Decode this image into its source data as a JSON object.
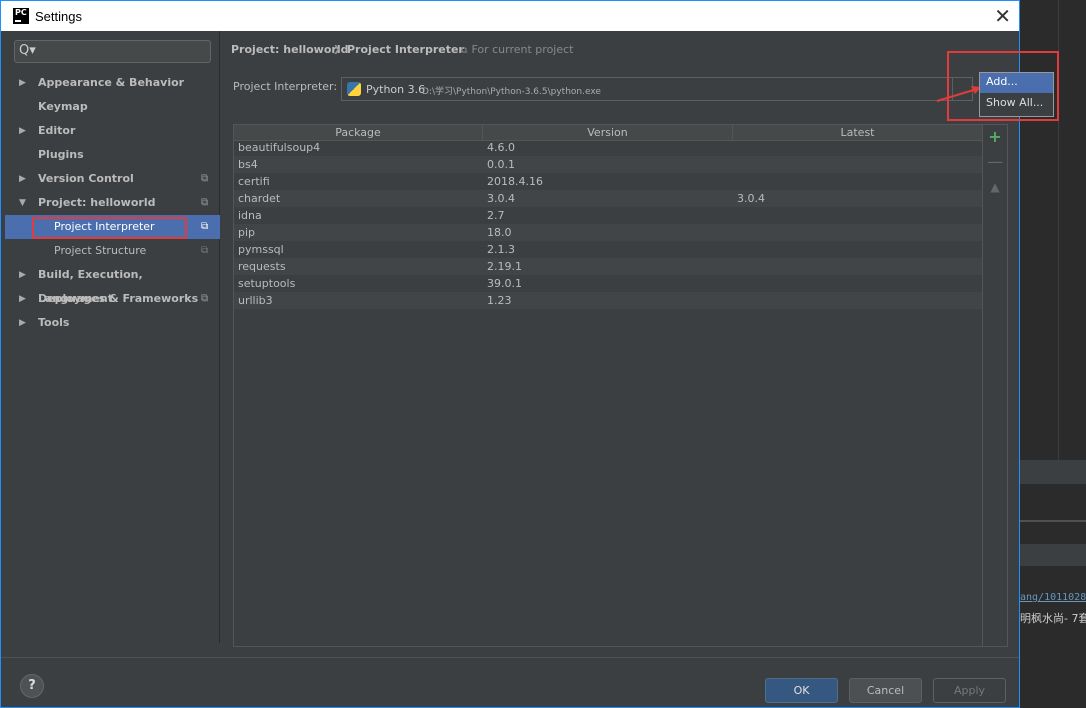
{
  "window": {
    "title": "Settings",
    "app_icon": "PC",
    "close": "✕"
  },
  "sidebar": {
    "search_icon": "Q▾",
    "items": [
      {
        "label": "Appearance & Behavior",
        "arrow": "▶",
        "copy": ""
      },
      {
        "label": "Keymap",
        "arrow": "",
        "copy": ""
      },
      {
        "label": "Editor",
        "arrow": "▶",
        "copy": ""
      },
      {
        "label": "Plugins",
        "arrow": "",
        "copy": ""
      },
      {
        "label": "Version Control",
        "arrow": "▶",
        "copy": "⧉"
      },
      {
        "label": "Project: helloworld",
        "arrow": "▼",
        "copy": "⧉"
      },
      {
        "label": "Project Interpreter",
        "arrow": "",
        "copy": "⧉"
      },
      {
        "label": "Project Structure",
        "arrow": "",
        "copy": "⧉"
      },
      {
        "label": "Build, Execution, Deployment",
        "arrow": "▶",
        "copy": ""
      },
      {
        "label": "Languages & Frameworks",
        "arrow": "▶",
        "copy": "⧉"
      },
      {
        "label": "Tools",
        "arrow": "▶",
        "copy": ""
      }
    ]
  },
  "breadcrumb": {
    "project": "Project: helloworld",
    "sep": "❯",
    "page": "Project Interpreter",
    "scope_icon": "⧉",
    "scope": "For current project"
  },
  "interpreter": {
    "label": "Project Interpreter:",
    "name": "Python 3.6",
    "path": "D:\\学习\\Python\\Python-3.6.5\\python.exe"
  },
  "popup": {
    "add": "Add...",
    "show_all": "Show All..."
  },
  "table": {
    "headers": [
      "Package",
      "Version",
      "Latest"
    ],
    "rows": [
      [
        "beautifulsoup4",
        "4.6.0",
        ""
      ],
      [
        "bs4",
        "0.0.1",
        ""
      ],
      [
        "certifi",
        "2018.4.16",
        ""
      ],
      [
        "chardet",
        "3.0.4",
        "3.0.4"
      ],
      [
        "idna",
        "2.7",
        ""
      ],
      [
        "pip",
        "18.0",
        ""
      ],
      [
        "pymssql",
        "2.1.3",
        ""
      ],
      [
        "requests",
        "2.19.1",
        ""
      ],
      [
        "setuptools",
        "39.0.1",
        ""
      ],
      [
        "urllib3",
        "1.23",
        ""
      ]
    ],
    "toolbar": {
      "add": "+",
      "remove": "—",
      "up": "▲"
    }
  },
  "buttons": {
    "help": "?",
    "ok": "OK",
    "cancel": "Cancel",
    "apply": "Apply"
  },
  "background": {
    "link": "ang/1011028",
    "text": "明枫水尚- 7套"
  }
}
